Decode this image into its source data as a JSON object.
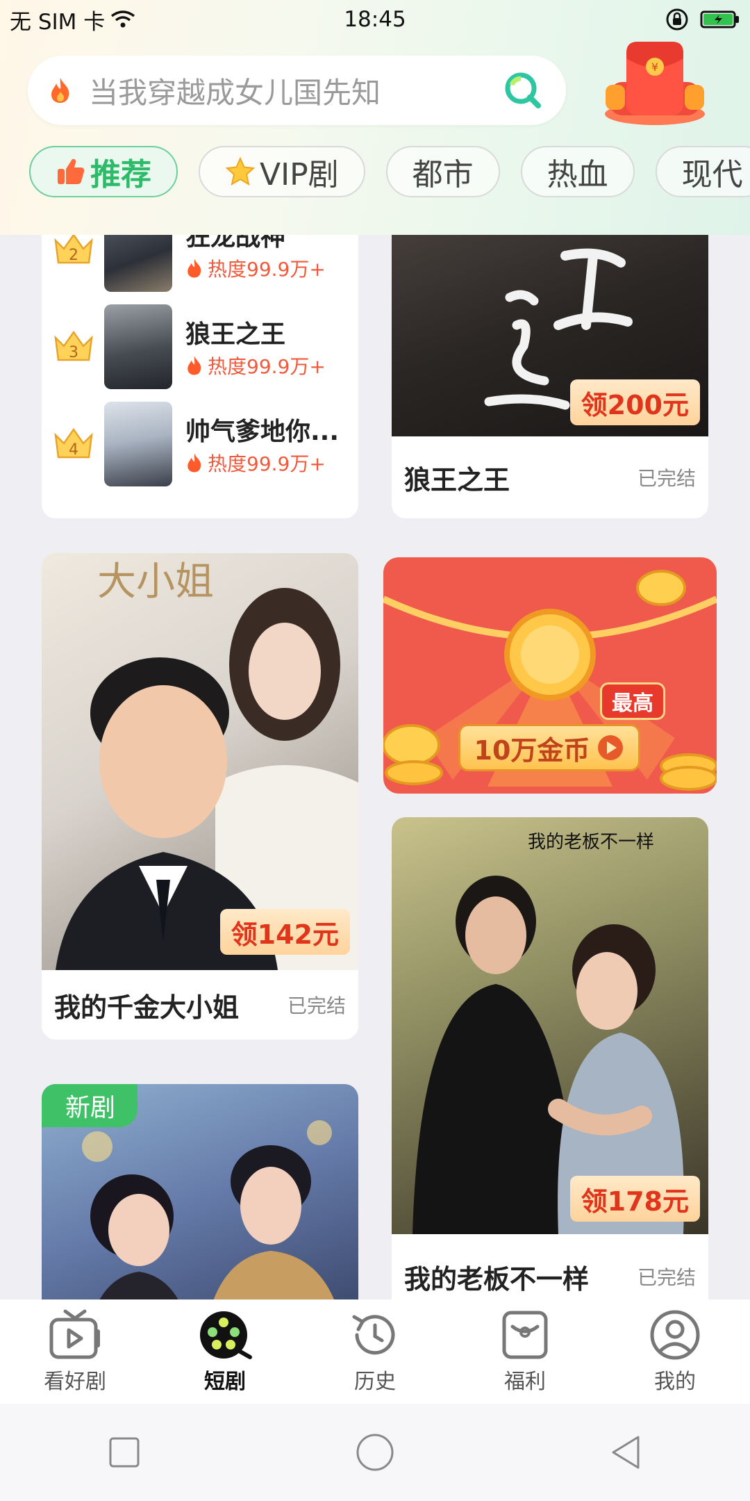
{
  "status_bar": {
    "carrier": "无 SIM 卡",
    "time": "18:45"
  },
  "search": {
    "placeholder": "当我穿越成女儿国先知"
  },
  "tabs": [
    {
      "label": "推荐",
      "icon": "thumbs-up-icon",
      "active": true
    },
    {
      "label": "VIP剧",
      "icon": "star-icon",
      "active": false
    },
    {
      "label": "都市",
      "active": false
    },
    {
      "label": "热血",
      "active": false
    },
    {
      "label": "现代",
      "active": false
    }
  ],
  "ranking": [
    {
      "rank": "2",
      "title": "狂龙战神",
      "heat": "热度99.9万+"
    },
    {
      "rank": "3",
      "title": "狼王之王",
      "heat": "热度99.9万+"
    },
    {
      "rank": "4",
      "title": "帅气爹地你...",
      "heat": "热度99.9万+"
    }
  ],
  "cards": {
    "wolf_king": {
      "title": "狼王之王",
      "status": "已完结",
      "coupon": "领200元"
    },
    "daughter": {
      "title": "我的千金大小姐",
      "status": "已完结",
      "coupon": "领142元"
    },
    "boss": {
      "title": "我的老板不一样",
      "status": "已完结",
      "coupon": "领178元"
    },
    "new_drama": {
      "badge": "新剧"
    }
  },
  "banner": {
    "tag": "最高",
    "reward": "10万金币"
  },
  "bottom_nav": [
    {
      "label": "看好剧",
      "icon": "tv-icon",
      "active": false
    },
    {
      "label": "短剧",
      "icon": "film-reel-icon",
      "active": true
    },
    {
      "label": "历史",
      "icon": "history-icon",
      "active": false
    },
    {
      "label": "福利",
      "icon": "gift-icon",
      "active": false
    },
    {
      "label": "我的",
      "icon": "user-icon",
      "active": false
    }
  ],
  "colors": {
    "accent_green": "#2dbb6a",
    "heat_red": "#f05a3c",
    "coupon_red": "#e0351a"
  }
}
